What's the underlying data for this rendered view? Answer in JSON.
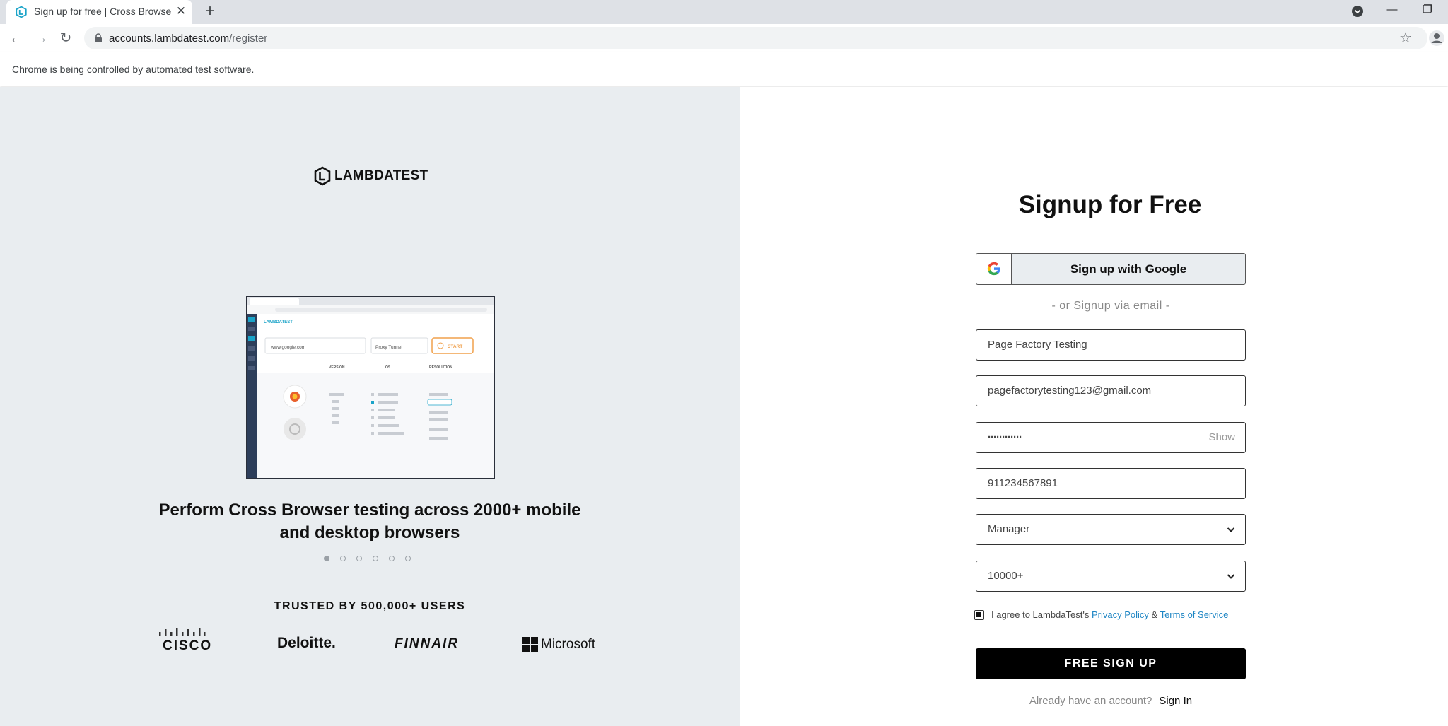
{
  "browser": {
    "tab_title": "Sign up for free | Cross Browser T",
    "url_host": "accounts.lambdatest.com",
    "url_path": "/register",
    "infobar": "Chrome is being controlled by automated test software.",
    "icons": {
      "back": "arrow-left-icon",
      "forward": "arrow-right-icon",
      "reload": "reload-icon",
      "lock": "lock-icon",
      "star": "star-icon",
      "close": "close-icon",
      "new_tab": "plus-icon"
    }
  },
  "left": {
    "brand": "LAMBDATEST",
    "caption": "Perform Cross Browser testing across 2000+ mobile and desktop browsers",
    "carousel_count": 6,
    "carousel_active": 0,
    "trusted": "TRUSTED BY 500,000+ USERS",
    "logos": {
      "cisco": "CISCO",
      "deloitte": "Deloitte.",
      "finnair": "FINNAIR",
      "microsoft": "Microsoft"
    },
    "preview": {
      "url": "www.google.com",
      "tunnel": "Proxy Tunnel",
      "start": "START",
      "columns": [
        "VERSION",
        "OS",
        "RESOLUTION"
      ]
    }
  },
  "form": {
    "title": "Signup for Free",
    "google_label": "Sign up with Google",
    "or_text": "- or Signup via email -",
    "name_value": "Page Factory Testing",
    "email_value": "pagefactorytesting123@gmail.com",
    "password_value": "············",
    "password_show": "Show",
    "phone_value": "911234567891",
    "designation_value": "Manager",
    "company_size_value": "10000+",
    "agree_prefix": "I agree to LambdaTest's",
    "privacy": "Privacy Policy",
    "amp": "&",
    "terms": "Terms of Service",
    "agree_checked": true,
    "submit": "FREE SIGN UP",
    "have_account": "Already have an account?",
    "sign_in": "Sign In"
  },
  "colors": {
    "accent_link": "#1f86c4",
    "left_bg": "#e9edf0",
    "button_bg": "#000000",
    "tabstrip_bg": "#dee1e6"
  }
}
